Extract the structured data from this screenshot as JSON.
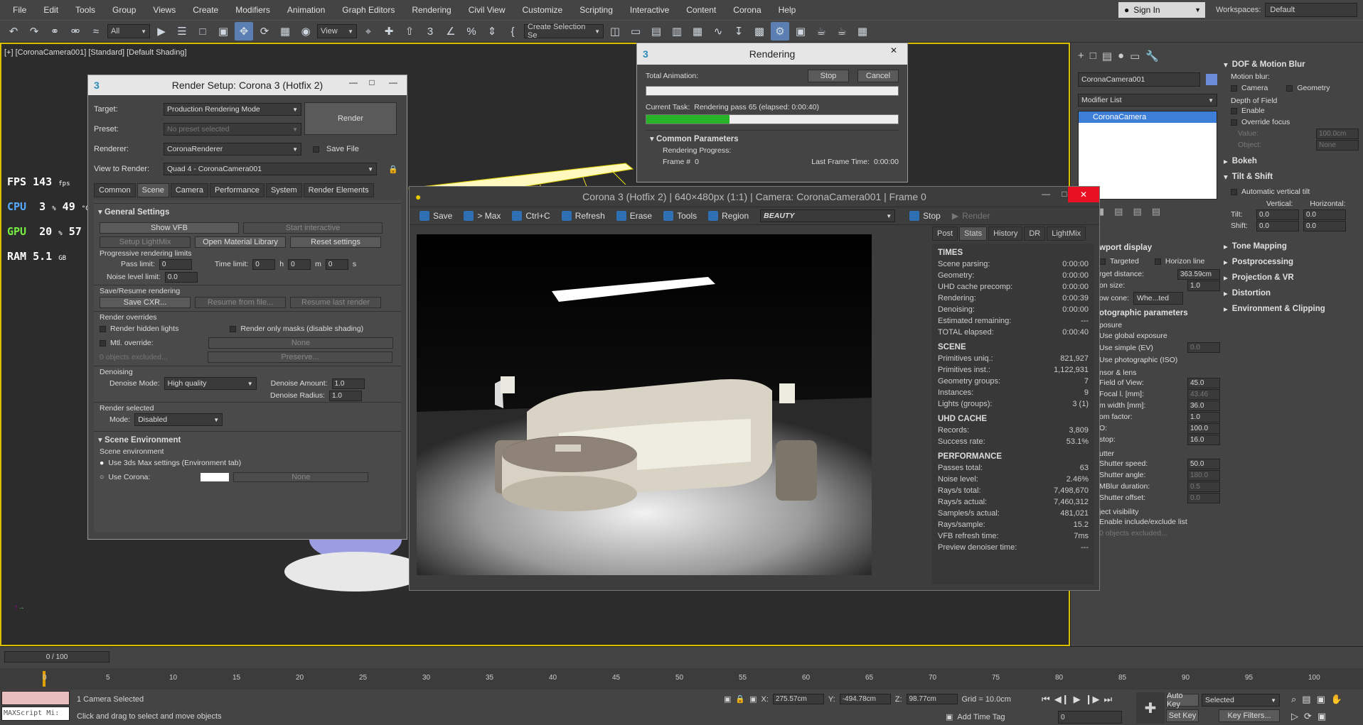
{
  "menu": [
    "File",
    "Edit",
    "Tools",
    "Group",
    "Views",
    "Create",
    "Modifiers",
    "Animation",
    "Graph Editors",
    "Rendering",
    "Civil View",
    "Customize",
    "Scripting",
    "Interactive",
    "Content",
    "Corona",
    "Help"
  ],
  "signin": {
    "label": "Sign In"
  },
  "workspaces": {
    "label": "Workspaces:",
    "value": "Default"
  },
  "toolbar": {
    "filter": "All",
    "view": "View",
    "selection_set": "Create Selection Se"
  },
  "viewport": {
    "label": "[+] [CoronaCamera001] [Standard] [Default Shading]"
  },
  "hud": {
    "fps_label": "FPS",
    "fps": "143",
    "fps_unit": "fps",
    "cpu_label": "CPU",
    "cpu": "3",
    "cpu_unit": "%",
    "cpu_temp": "49",
    "cpu_temp_unit": "°C",
    "gpu_label": "GPU",
    "gpu": "20",
    "gpu_unit": "%",
    "gpu_temp": "57",
    "gpu_temp_unit": "°C",
    "ram_label": "RAM",
    "ram": "5.1",
    "ram_unit": "GB"
  },
  "render_setup": {
    "title": "Render Setup: Corona 3 (Hotfix 2)",
    "target_label": "Target:",
    "target": "Production Rendering Mode",
    "preset_label": "Preset:",
    "preset": "No preset selected",
    "renderer_label": "Renderer:",
    "renderer": "CoronaRenderer",
    "save_file": "Save File",
    "view_label": "View to Render:",
    "view": "Quad 4 - CoronaCamera001",
    "render_button": "Render",
    "tabs": [
      "Common",
      "Scene",
      "Camera",
      "Performance",
      "System",
      "Render Elements"
    ],
    "general_settings": "General Settings",
    "show_vfb": "Show VFB",
    "start_interactive": "Start interactive",
    "setup_lightmix": "Setup LightMix",
    "open_material_library": "Open Material Library",
    "reset_settings": "Reset settings",
    "prog_limits": "Progressive rendering limits",
    "pass_limit_label": "Pass limit:",
    "pass_limit": "0",
    "time_limit_label": "Time limit:",
    "time_h": "0",
    "time_m": "0",
    "time_s": "0",
    "h": "h",
    "m": "m",
    "s": "s",
    "noise_label": "Noise level limit:",
    "noise": "0.0",
    "save_resume": "Save/Resume rendering",
    "save_cxr": "Save CXR...",
    "resume_file": "Resume from file...",
    "resume_last": "Resume last render",
    "overrides": "Render overrides",
    "render_hidden": "Render hidden lights",
    "render_masks": "Render only masks (disable shading)",
    "mtl_override": "Mtl. override:",
    "mtl_none": "None",
    "objects_excluded": "0 objects excluded...",
    "preserve": "Preserve...",
    "denoising": "Denoising",
    "denoise_mode_label": "Denoise Mode:",
    "denoise_mode": "High quality",
    "denoise_amount_label": "Denoise Amount:",
    "denoise_amount": "1.0",
    "denoise_radius_label": "Denoise Radius:",
    "denoise_radius": "1.0",
    "render_selected": "Render selected",
    "mode_label": "Mode:",
    "mode": "Disabled",
    "scene_env": "Scene Environment",
    "scene_env_sub": "Scene environment",
    "use_max": "Use 3ds Max settings (Environment tab)",
    "use_corona": "Use Corona:",
    "corona_none": "None"
  },
  "rendering": {
    "title": "Rendering",
    "total_animation": "Total Animation:",
    "stop": "Stop",
    "cancel": "Cancel",
    "current_task_label": "Current Task:",
    "current_task": "Rendering pass 65 (elapsed: 0:00:40)",
    "progress": 0.33,
    "common_params": "Common Parameters",
    "rendering_progress": "Rendering Progress:",
    "frame_label": "Frame #",
    "frame": "0",
    "last_frame_label": "Last Frame Time:",
    "last_frame": "0:00:00"
  },
  "vfb": {
    "title": "Corona 3 (Hotfix 2) | 640×480px (1:1) | Camera: CoronaCamera001 | Frame 0",
    "toolbar": [
      "Save",
      "> Max",
      "Ctrl+C",
      "Refresh",
      "Erase",
      "Tools",
      "Region"
    ],
    "channel": "BEAUTY",
    "stop": "Stop",
    "render": "Render",
    "tabs": [
      "Post",
      "Stats",
      "History",
      "DR",
      "LightMix"
    ],
    "times_h": "TIMES",
    "times": [
      [
        "Scene parsing:",
        "0:00:00"
      ],
      [
        "Geometry:",
        "0:00:00"
      ],
      [
        "UHD cache precomp:",
        "0:00:00"
      ],
      [
        "Rendering:",
        "0:00:39"
      ],
      [
        "Denoising:",
        "0:00:00"
      ],
      [
        "Estimated remaining:",
        "---"
      ],
      [
        "TOTAL elapsed:",
        "0:00:40"
      ]
    ],
    "scene_h": "SCENE",
    "scene": [
      [
        "Primitives uniq.:",
        "821,927"
      ],
      [
        "Primitives inst.:",
        "1,122,931"
      ],
      [
        "Geometry groups:",
        "7"
      ],
      [
        "Instances:",
        "9"
      ],
      [
        "Lights (groups):",
        "3 (1)"
      ]
    ],
    "uhd_h": "UHD CACHE",
    "uhd": [
      [
        "Records:",
        "3,809"
      ],
      [
        "Success rate:",
        "53.1%"
      ]
    ],
    "perf_h": "PERFORMANCE",
    "perf": [
      [
        "Passes total:",
        "63"
      ],
      [
        "Noise level:",
        "2.46%"
      ],
      [
        "Rays/s total:",
        "7,498,670"
      ],
      [
        "Rays/s actual:",
        "7,460,312"
      ],
      [
        "Samples/s actual:",
        "481,021"
      ],
      [
        "Rays/sample:",
        "15.2"
      ],
      [
        "VFB refresh time:",
        "7ms"
      ],
      [
        "Preview denoiser time:",
        "---"
      ]
    ]
  },
  "command_panel": {
    "object_name": "CoronaCamera001",
    "modifier_list": "Modifier List",
    "stack_item": "CoronaCamera",
    "viewport_display": "wport display",
    "targeted": "Targeted",
    "horizon_line": "Horizon line",
    "target_distance_label": "rget distance:",
    "target_distance": "363.59cm",
    "icon_size_label": "on size:",
    "icon_size": "1.0",
    "view_cone_label": "ow cone:",
    "view_cone": "Whe...ted",
    "photo_params": "otographic parameters",
    "exposure": "posure",
    "use_global": "Use global exposure",
    "use_simple": "Use simple (EV)",
    "simple_val": "0.0",
    "use_photo": "Use photographic (ISO)",
    "sensor": "nsor & lens",
    "fov_label": "Field of View:",
    "fov": "45.0",
    "focal_label": "Focal l. [mm]:",
    "focal": "43.46",
    "film_label": "m width [mm]:",
    "film": "36.0",
    "zoom_label": "om factor:",
    "zoom": "1.0",
    "iso_label": "O:",
    "iso": "100.0",
    "fstop_label": "stop:",
    "fstop": "16.0",
    "shutter": "utter",
    "shutter_speed_label": "Shutter speed:",
    "shutter_speed": "50.0",
    "shutter_angle_label": "Shutter angle:",
    "shutter_angle": "180.0",
    "mblur_label": "MBlur duration:",
    "mblur": "0.5",
    "shutter_offset_label": "Shutter offset:",
    "shutter_offset": "0.0",
    "obj_visibility": "ject visibility",
    "enable_include": "Enable include/exclude list",
    "objs_excluded": "0 objects excluded...",
    "dof_motion": "DOF & Motion Blur",
    "motion_blur": "Motion blur:",
    "camera": "Camera",
    "geometry": "Geometry",
    "depth_of_field": "Depth of Field",
    "enable": "Enable",
    "override_focus": "Override focus",
    "value_label": "Value:",
    "value": "100.0cm",
    "object_label": "Object:",
    "object": "None",
    "rollouts": [
      "Bokeh",
      "Tilt & Shift"
    ],
    "auto_tilt": "Automatic vertical tilt",
    "vertical": "Vertical:",
    "horizontal": "Horizontal:",
    "tilt_label": "Tilt:",
    "tilt_v": "0.0",
    "tilt_h": "0.0",
    "shift_label": "Shift:",
    "shift_v": "0.0",
    "shift_h": "0.0",
    "more_rollouts": [
      "Tone Mapping",
      "Postprocessing",
      "Projection & VR",
      "Distortion",
      "Environment & Clipping"
    ]
  },
  "timeline": {
    "frame": "0 / 100",
    "ticks": [
      "0",
      "5",
      "10",
      "15",
      "20",
      "25",
      "30",
      "35",
      "40",
      "45",
      "50",
      "55",
      "60",
      "65",
      "70",
      "75",
      "80",
      "85",
      "90",
      "95",
      "100"
    ],
    "maxscript": "MAXScript Mi:",
    "status1": "1 Camera Selected",
    "status2": "Click and drag to select and move objects",
    "x_label": "X:",
    "x": "275.57cm",
    "y_label": "Y:",
    "y": "-494.78cm",
    "z_label": "Z:",
    "z": "98.77cm",
    "grid": "Grid = 10.0cm",
    "add_time_tag": "Add Time Tag",
    "auto_key": "Auto Key",
    "selected": "Selected",
    "set_key": "Set Key",
    "key_filters": "Key Filters...",
    "frame_field": "0"
  }
}
